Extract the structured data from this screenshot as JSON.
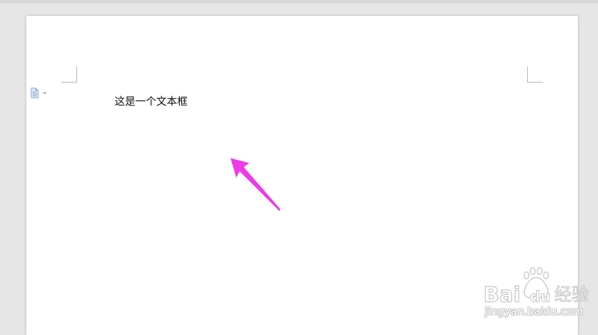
{
  "document": {
    "text_box_content": "这是一个文本框"
  },
  "annotation": {
    "arrow_color": "#ee3ae9"
  },
  "watermark": {
    "logo_text": "Baidu经验",
    "url": "jingyan.baidu.com"
  },
  "icons": {
    "paragraph_options": "document-options-icon",
    "dropdown": "small-triangle-down-icon"
  },
  "colors": {
    "workspace_bg": "#e6e6e6",
    "page_bg": "#ffffff",
    "margin_mark": "#b4b4b4",
    "icon_blue": "#8aa9d6"
  }
}
